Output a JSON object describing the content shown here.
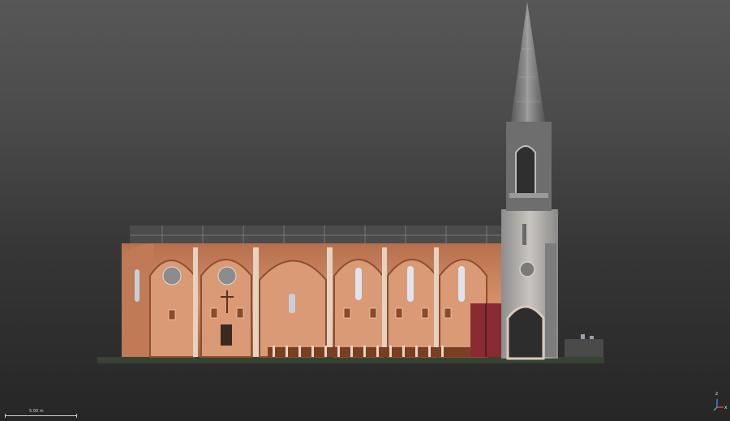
{
  "scene": {
    "background_top": "#575757",
    "background_bottom": "#262626",
    "brick_color": "#c98561",
    "stone_color": "#b8b0a8",
    "subject": "church-point-cloud-section"
  },
  "scale_bar": {
    "label": "5.00 m"
  },
  "axis_gizmo": {
    "z_label": "z",
    "x_label": "x",
    "x_color": "#e04040",
    "y_color": "#40c040",
    "z_color": "#4080ff"
  }
}
